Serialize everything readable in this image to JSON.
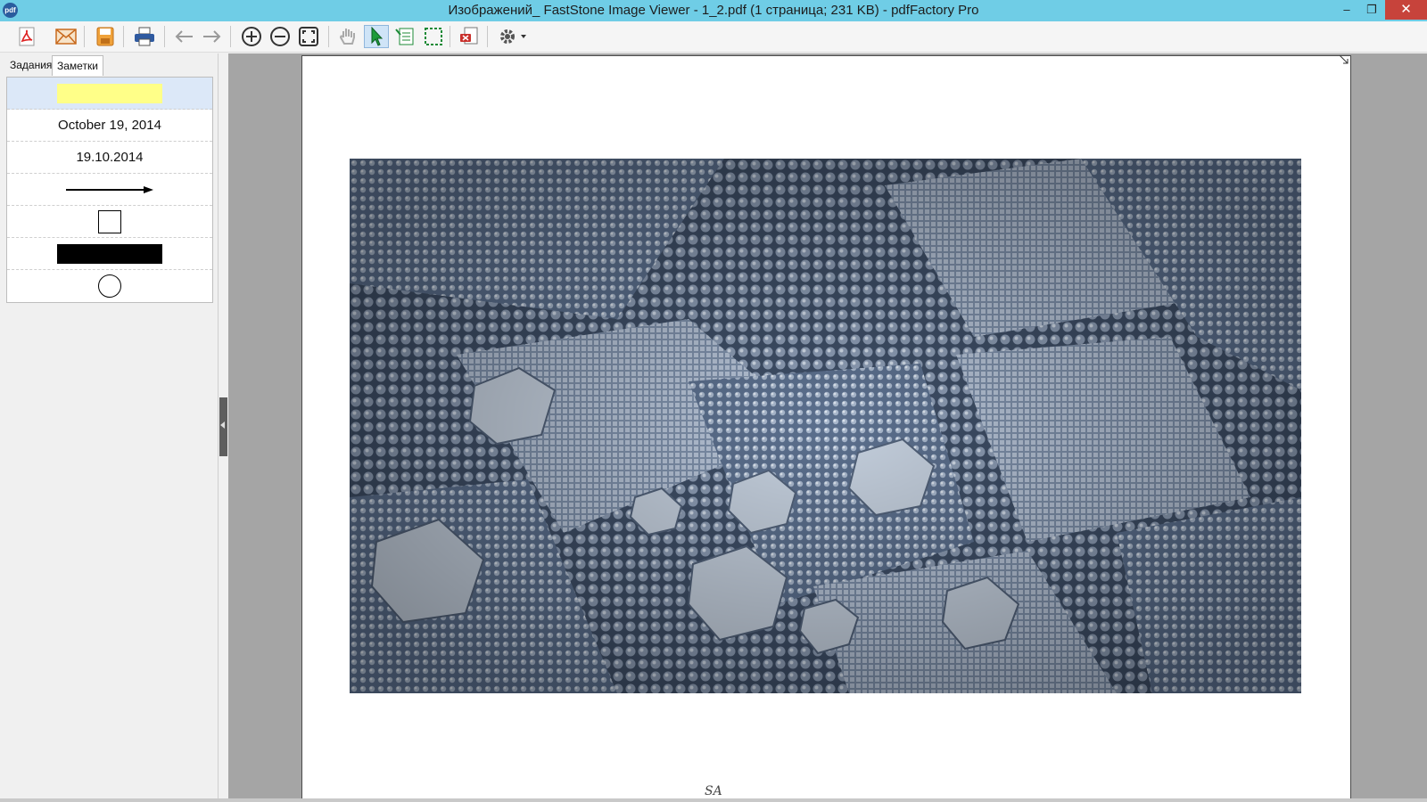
{
  "window": {
    "app_icon_text": "pdf",
    "title": "Изображений_ FastStone Image Viewer - 1_2.pdf (1 страница; 231 KB) - pdfFactory Pro",
    "minimize": "–",
    "maximize": "❐",
    "close": "✕"
  },
  "toolbar": {
    "buttons": [
      "pdf-icon",
      "email-icon",
      "save-icon",
      "print-icon",
      "back-arrow-icon",
      "forward-arrow-icon",
      "zoom-in-icon",
      "zoom-out-icon",
      "fit-page-icon",
      "hand-tool-icon",
      "select-arrow-icon",
      "text-select-icon",
      "marquee-select-icon",
      "delete-icon",
      "settings-icon"
    ]
  },
  "left_panel": {
    "tabs": [
      "Задания",
      "Заметки"
    ],
    "active_tab": "Заметки",
    "notes": [
      {
        "kind": "highlight",
        "color": "#ffff88"
      },
      {
        "kind": "text",
        "text": "October 19, 2014"
      },
      {
        "kind": "text",
        "text": "19.10.2014"
      },
      {
        "kind": "arrow"
      },
      {
        "kind": "rectangle"
      },
      {
        "kind": "filled-rectangle",
        "color": "#000000"
      },
      {
        "kind": "circle"
      }
    ]
  },
  "document": {
    "footer_text": "SA"
  },
  "colors": {
    "titlebar": "#6fcde6",
    "close_button": "#c7433b",
    "workspace": "#a5a5a5",
    "selected_note": "#dce8f8"
  }
}
